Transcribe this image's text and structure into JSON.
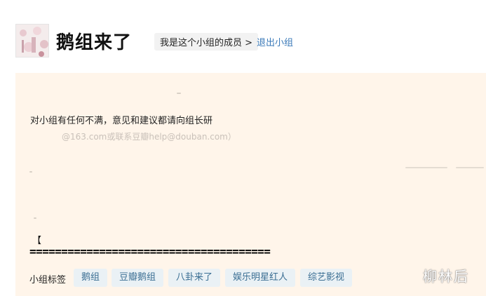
{
  "header": {
    "title": "鹅组来了",
    "member_status": "我是这个小组的成员 >",
    "quit_link": "退出小组"
  },
  "panel": {
    "intro": "对小组有任何不满，意见和建议都请向组长研",
    "faded_email": "@163.com或联系豆瓣help@douban.com）",
    "bracket_text": "【",
    "divider": "======================================"
  },
  "tags": {
    "label": "小组标签",
    "items": [
      "鹅组",
      "豆瓣鹅组",
      "八卦来了",
      "娱乐明星红人",
      "综艺影视"
    ]
  },
  "watermark": "柳林后",
  "colors": {
    "panel_bg": "#fff5ea",
    "link": "#3a79b8",
    "tag_bg": "#eaf1f5",
    "tag_text": "#3a6e93"
  }
}
